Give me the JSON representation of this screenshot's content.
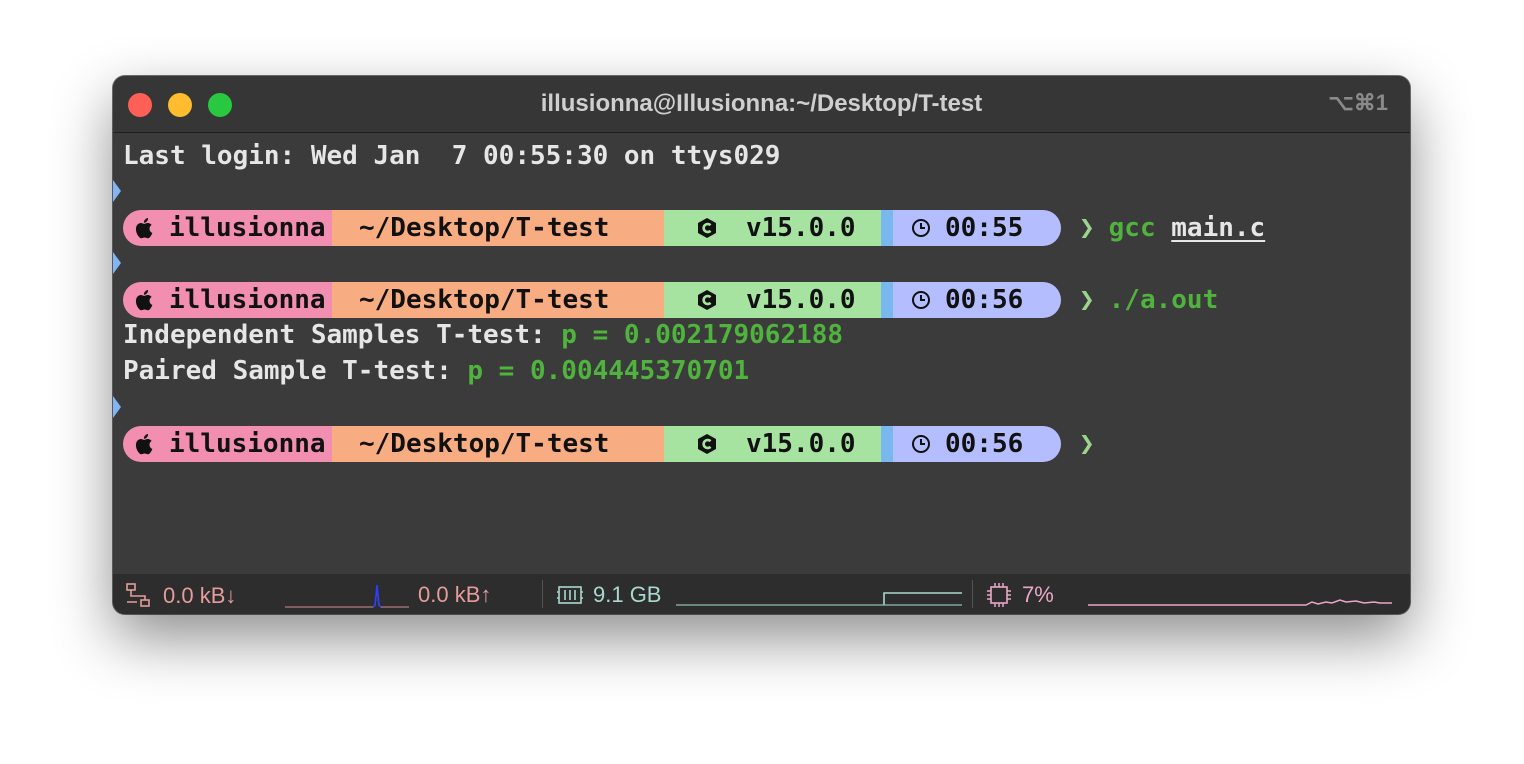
{
  "window": {
    "title": "illusionna@Illusionna:~/Desktop/T-test",
    "shortcut": "⌥⌘1"
  },
  "terminal": {
    "last_login": "Last login: Wed Jan  7 00:55:30 on ttys029",
    "prompts": [
      {
        "user": "illusionna",
        "dir": "~/Desktop/T-test",
        "compiler": "v15.0.0",
        "time": "00:55",
        "chevron": "❯",
        "cmd": "gcc",
        "arg": "main.c"
      },
      {
        "user": "illusionna",
        "dir": "~/Desktop/T-test",
        "compiler": "v15.0.0",
        "time": "00:56",
        "chevron": "❯",
        "cmd": "./a.out",
        "arg": ""
      },
      {
        "user": "illusionna",
        "dir": "~/Desktop/T-test",
        "compiler": "v15.0.0",
        "time": "00:56",
        "chevron": "❯",
        "cmd": "",
        "arg": ""
      }
    ],
    "output": [
      {
        "label": "Independent Samples T-test: ",
        "value": "p = 0.002179062188"
      },
      {
        "label": "Paired Sample T-test: ",
        "value": "p = 0.004445370701"
      }
    ]
  },
  "statusbar": {
    "net_down": "0.0 kB↓",
    "net_up": "0.0 kB↑",
    "memory": "9.1 GB",
    "cpu": "7%",
    "colors": {
      "net": "#e49c9c",
      "memory": "#a8d9cf",
      "cpu": "#e9a8c8",
      "net_spike": "#2b3cff"
    }
  },
  "colors": {
    "user_segment": "#f28fb1",
    "dir_segment": "#f7ad81",
    "compiler_segment": "#a6e3a1",
    "time_segment": "#b4befe",
    "output_value": "#4fb33d",
    "marker": "#82b5f3"
  },
  "icons": {
    "user": "apple-icon",
    "compiler": "c-language-icon",
    "time": "clock-icon",
    "network": "network-icon",
    "memory": "memory-chip-icon",
    "cpu": "cpu-icon"
  }
}
